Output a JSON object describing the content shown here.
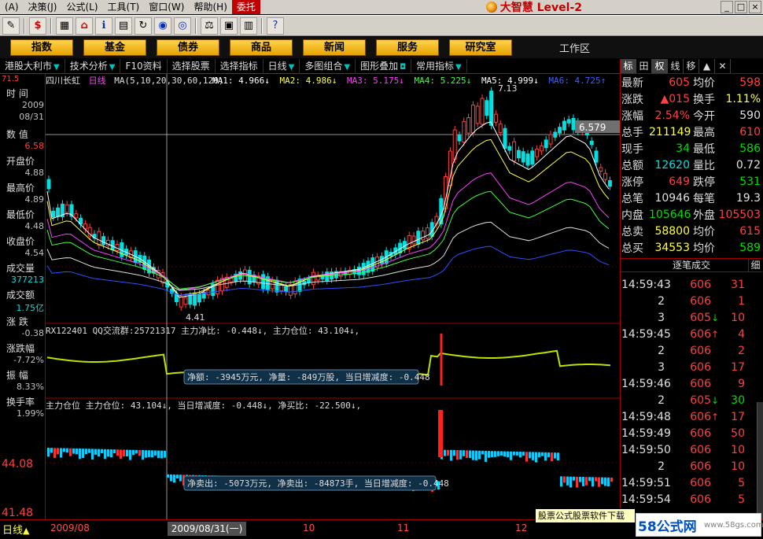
{
  "menu": {
    "items": [
      "(A)",
      "决策(J)",
      "公式(L)",
      "工具(T)",
      "窗口(W)",
      "帮助(H)",
      "委托"
    ],
    "brand": "大智慧 Level-2"
  },
  "nav": {
    "buttons": [
      "指数",
      "基金",
      "债券",
      "商品",
      "新闻",
      "服务",
      "研究室"
    ],
    "workzone": "工作区"
  },
  "subbar": {
    "items": [
      "港股大利市",
      "技术分析",
      "F10资料",
      "选择股票",
      "选择指标",
      "日线",
      "多图组合",
      "图形叠加",
      "常用指标"
    ]
  },
  "left": {
    "rows": [
      {
        "label": "时  间",
        "value": "2009"
      },
      {
        "label": "",
        "value": "08/31"
      },
      {
        "label": "数  值",
        "value": "6.58"
      },
      {
        "label": "开盘价",
        "value": "4.88"
      },
      {
        "label": "最高价",
        "value": "4.89"
      },
      {
        "label": "最低价",
        "value": "4.48"
      },
      {
        "label": "收盘价",
        "value": "4.54"
      },
      {
        "label": "成交量",
        "value": "377213"
      },
      {
        "label": "成交额",
        "value": "1.75亿"
      },
      {
        "label": "涨  跌",
        "value": "-0.38"
      },
      {
        "label": "涨跌幅",
        "value": "-7.72%"
      },
      {
        "label": "振  幅",
        "value": "8.33%"
      },
      {
        "label": "换手率",
        "value": "1.99%"
      }
    ]
  },
  "chart": {
    "stock": "四川长虹",
    "period": "日线",
    "ma_header": "MA(5,10,20,30,60,120)",
    "ma_values": [
      {
        "label": "MA1: 4.966↓",
        "color": "#ffffff"
      },
      {
        "label": "MA2: 4.986↓",
        "color": "#ffff40"
      },
      {
        "label": "MA3: 5.175↓",
        "color": "#ff40ff"
      },
      {
        "label": "MA4: 5.225↓",
        "color": "#40ff40"
      },
      {
        "label": "MA5: 4.999↓",
        "color": "#ffffff"
      },
      {
        "label": "MA6: 4.725↑",
        "color": "#4060ff"
      }
    ],
    "hi_label": "7.13",
    "lo_label": "4.41",
    "price_tag": "6.579",
    "axis_y_top": "71.5",
    "indicator1_header": "RX122401 QQ交流群:25721317 主力净比: -0.448↓, 主力仓位: 43.104↓,",
    "tooltip1": "净额: -3945万元, 净量: -849万股, 当日增减度: -0.448",
    "indicator2_header": "主力仓位  主力仓位: 43.104↓, 当日增减度: -0.448↓, 净买比: -22.500↓,",
    "tooltip2": "净卖出: -5073万元, 净卖出: -84873手, 当日增减度: -0.448",
    "axis2_top": "44.08",
    "axis2_bottom": "41.48"
  },
  "right": {
    "tabs": [
      "标",
      "田",
      "权",
      "线",
      "移",
      "▲",
      "✕"
    ],
    "quotes": [
      {
        "k": "最新",
        "v": "605",
        "vc": "red",
        "k2": "均价",
        "v2": "598",
        "v2c": "red"
      },
      {
        "k": "涨跌",
        "v": "▲015",
        "vc": "red",
        "k2": "换手",
        "v2": "1.11%",
        "v2c": "yellow"
      },
      {
        "k": "涨幅",
        "v": "2.54%",
        "vc": "red",
        "k2": "今开",
        "v2": "590",
        "v2c": "white"
      },
      {
        "k": "总手",
        "v": "211149",
        "vc": "yellow",
        "k2": "最高",
        "v2": "610",
        "v2c": "red"
      },
      {
        "k": "现手",
        "v": "34",
        "vc": "green",
        "k2": "最低",
        "v2": "586",
        "v2c": "green"
      },
      {
        "k": "总额",
        "v": "12620",
        "vc": "cyan",
        "k2": "量比",
        "v2": "0.72",
        "v2c": "white"
      },
      {
        "k": "涨停",
        "v": "649",
        "vc": "red",
        "k2": "跌停",
        "v2": "531",
        "v2c": "green"
      },
      {
        "k": "总笔",
        "v": "10946",
        "vc": "white",
        "k2": "每笔",
        "v2": "19.3",
        "v2c": "white"
      },
      {
        "k": "内盘",
        "v": "105646",
        "vc": "green",
        "k2": "外盘",
        "v2": "105503",
        "v2c": "red"
      },
      {
        "k": "总卖",
        "v": "58800",
        "vc": "yellow",
        "k2": "均价",
        "v2": "615",
        "v2c": "red"
      },
      {
        "k": "总买",
        "v": "34553",
        "vc": "yellow",
        "k2": "均价",
        "v2": "589",
        "v2c": "green"
      }
    ],
    "deal_header": "逐笔成交",
    "deal_tail": "细",
    "deals": [
      {
        "t": "14:59:43",
        "p": "606",
        "a": "",
        "v": "31",
        "c": "red"
      },
      {
        "t": "2",
        "p": "606",
        "a": "",
        "v": "1",
        "c": "red"
      },
      {
        "t": "3",
        "p": "605",
        "a": "↓",
        "v": "10",
        "c": "red"
      },
      {
        "t": "14:59:45",
        "p": "606",
        "a": "↑",
        "v": "4",
        "c": "red"
      },
      {
        "t": "2",
        "p": "606",
        "a": "",
        "v": "2",
        "c": "red"
      },
      {
        "t": "3",
        "p": "606",
        "a": "",
        "v": "17",
        "c": "red"
      },
      {
        "t": "14:59:46",
        "p": "606",
        "a": "",
        "v": "9",
        "c": "red"
      },
      {
        "t": "2",
        "p": "605",
        "a": "↓",
        "v": "30",
        "c": "green"
      },
      {
        "t": "14:59:48",
        "p": "606",
        "a": "↑",
        "v": "17",
        "c": "red"
      },
      {
        "t": "14:59:49",
        "p": "606",
        "a": "",
        "v": "50",
        "c": "red"
      },
      {
        "t": "14:59:50",
        "p": "606",
        "a": "",
        "v": "10",
        "c": "red"
      },
      {
        "t": "2",
        "p": "606",
        "a": "",
        "v": "10",
        "c": "red"
      },
      {
        "t": "14:59:51",
        "p": "606",
        "a": "",
        "v": "5",
        "c": "red"
      },
      {
        "t": "14:59:54",
        "p": "606",
        "a": "",
        "v": "5",
        "c": "red"
      }
    ]
  },
  "bottom": {
    "period_btn": "日线",
    "date_tag": "2009/08/31(一)",
    "x_labels": [
      "2009/08",
      "10",
      "11",
      "12"
    ],
    "promo": "股票公式股票软件下载",
    "watermark_main": "58公式网",
    "watermark_url": "www.58gs.com"
  }
}
